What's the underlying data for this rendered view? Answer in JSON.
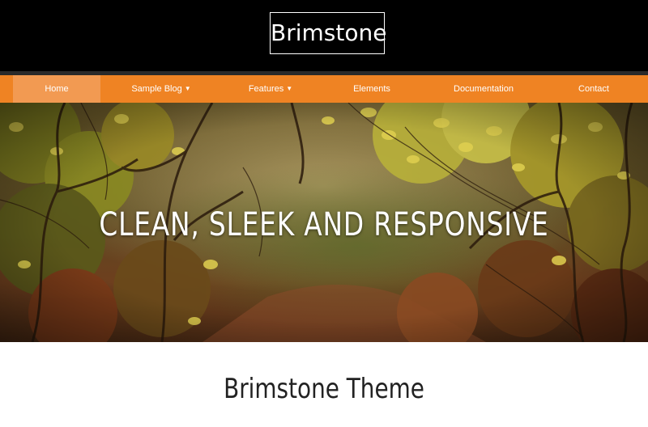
{
  "header": {
    "logo_text": "Brimstone"
  },
  "nav": {
    "items": [
      {
        "label": "Home",
        "active": true,
        "has_dropdown": false
      },
      {
        "label": "Sample Blog",
        "active": false,
        "has_dropdown": true
      },
      {
        "label": "Features",
        "active": false,
        "has_dropdown": true
      },
      {
        "label": "Elements",
        "active": false,
        "has_dropdown": false
      },
      {
        "label": "Documentation",
        "active": false,
        "has_dropdown": false
      },
      {
        "label": "Contact",
        "active": false,
        "has_dropdown": false
      }
    ],
    "caret_icon": "caret-down-icon"
  },
  "hero": {
    "headline": "CLEAN, SLEEK AND RESPONSIVE",
    "image_subject": "autumn forest"
  },
  "content": {
    "title": "Brimstone Theme"
  },
  "colors": {
    "header_bg": "#000000",
    "nav_bg": "#ef8323",
    "nav_active_bg": "#f29a52",
    "nav_text": "#ffffff",
    "page_bg": "#ffffff"
  }
}
